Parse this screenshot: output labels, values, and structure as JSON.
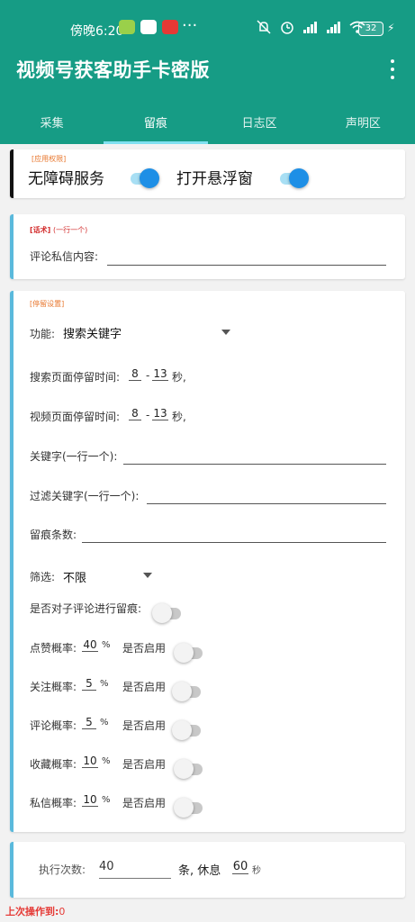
{
  "status_bar": {
    "time": "傍晚6:20",
    "more": "···",
    "battery": "32",
    "colors": [
      "#9ad04a",
      "#ffffff",
      "#e53935"
    ]
  },
  "app": {
    "title": "视频号获客助手卡密版"
  },
  "tabs": [
    "采集",
    "留痕",
    "日志区",
    "声明区"
  ],
  "permissions": {
    "tag": "[应用权限]",
    "accessibility_label": "无障碍服务",
    "accessibility_on": true,
    "overlay_label": "打开悬浮窗",
    "overlay_on": true
  },
  "script": {
    "tag": "[话术]",
    "tag_hint": "(一行一个)",
    "comment_label": "评论私信内容:",
    "comment_value": ""
  },
  "stay": {
    "tag": "[停留设置]",
    "function_label": "功能:",
    "function_value": "搜索关键字",
    "search_stay_label": "搜索页面停留时间:",
    "search_min": "8",
    "search_max": "13",
    "video_stay_label": "视频页面停留时间:",
    "video_min": "8",
    "video_max": "13",
    "dash": "-",
    "seconds_suffix": "秒,",
    "keywords_label": "关键字(一行一个):",
    "keywords_value": "",
    "filter_keywords_label": "过滤关键字(一行一个):",
    "filter_keywords_value": "",
    "trace_count_label": "留痕条数:",
    "trace_count_value": "",
    "filter_label": "筛选:",
    "filter_value": "不限",
    "sub_comment_label": "是否对子评论进行留痕:",
    "sub_comment_on": false,
    "enable_label": "是否启用",
    "percent": "%",
    "probabilities": [
      {
        "label": "点赞概率:",
        "value": "40",
        "enabled": false
      },
      {
        "label": "关注概率:",
        "value": "5",
        "enabled": false
      },
      {
        "label": "评论概率:",
        "value": "5",
        "enabled": false
      },
      {
        "label": "收藏概率:",
        "value": "10",
        "enabled": false
      },
      {
        "label": "私信概率:",
        "value": "10",
        "enabled": false
      }
    ]
  },
  "exec": {
    "count_label": "执行次数:",
    "count_value": "40",
    "rest_label": "条, 休息",
    "rest_value": "60",
    "rest_unit": "秒"
  },
  "footer": {
    "label": "上次操作到:",
    "value": "0"
  },
  "colors": {
    "primary": "#169c85",
    "accent_blue": "#1e8fe6",
    "card_bar": "#5ab9dc",
    "tag_orange": "#e8772e",
    "tag_red": "#d32f2f"
  }
}
